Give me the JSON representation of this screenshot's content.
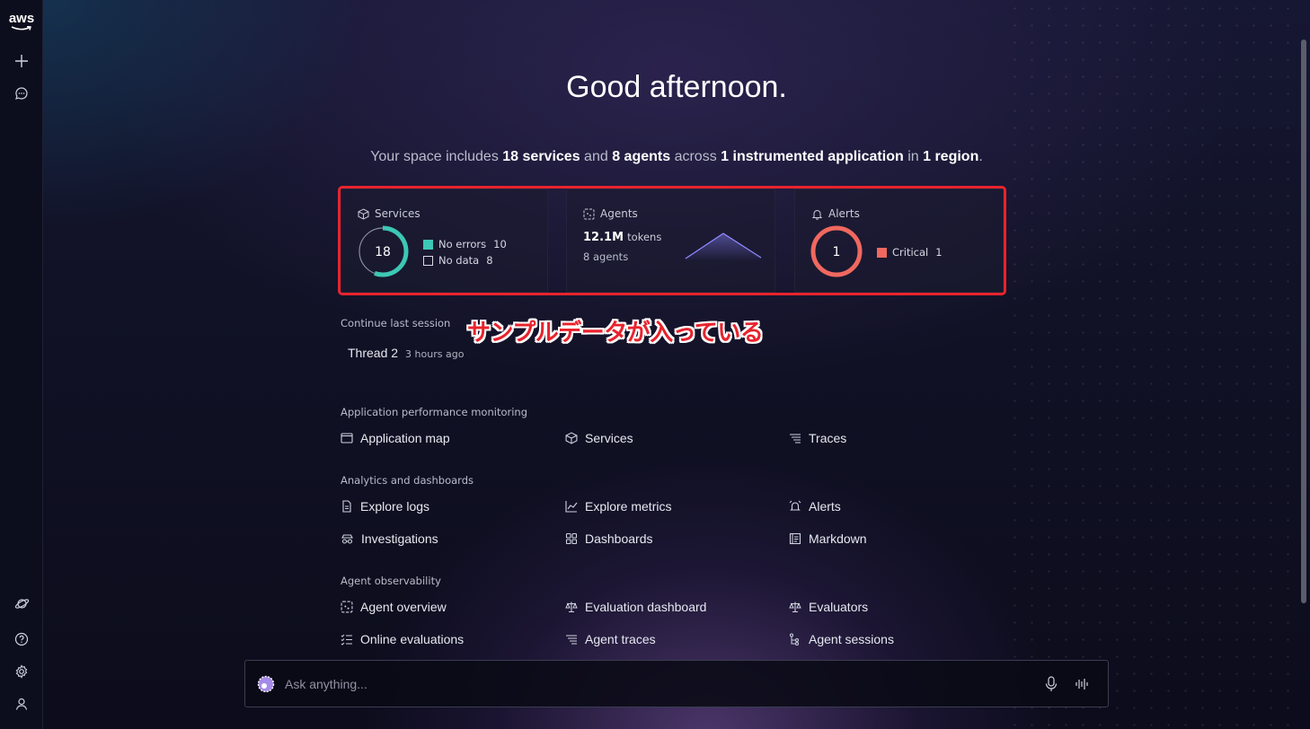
{
  "sidebar": {
    "logo": "aws"
  },
  "greeting": "Good afternoon.",
  "summary": {
    "prefix": "Your space includes",
    "services": "18 services",
    "and": "and",
    "agents": "8 agents",
    "across": "across",
    "apps": "1 instrumented application",
    "in": "in",
    "regions": "1 region",
    "end": "."
  },
  "cards": {
    "services": {
      "title": "Services",
      "total": "18",
      "legend": [
        {
          "label": "No errors",
          "value": "10",
          "color": "#3dc7b4"
        },
        {
          "label": "No data",
          "value": "8",
          "color": "transparent"
        }
      ]
    },
    "agents": {
      "title": "Agents",
      "tokens_value": "12.1M",
      "tokens_label": "tokens",
      "count_text": "8 agents"
    },
    "alerts": {
      "title": "Alerts",
      "total": "1",
      "legend": [
        {
          "label": "Critical",
          "value": "1",
          "color": "#f0685f"
        }
      ]
    }
  },
  "annotation": "サンプルデータが入っている",
  "session": {
    "label": "Continue last session",
    "thread": "Thread 2",
    "time": "3 hours ago"
  },
  "sections": [
    {
      "label": "Application performance monitoring",
      "links": [
        "Application map",
        "Services",
        "Traces"
      ]
    },
    {
      "label": "Analytics and dashboards",
      "links": [
        "Explore logs",
        "Explore metrics",
        "Alerts",
        "Investigations",
        "Dashboards",
        "Markdown"
      ]
    },
    {
      "label": "Agent observability",
      "links": [
        "Agent overview",
        "Evaluation dashboard",
        "Evaluators",
        "Online evaluations",
        "Agent traces",
        "Agent sessions"
      ]
    }
  ],
  "ask": {
    "placeholder": "Ask anything..."
  },
  "colors": {
    "teal": "#3dc7b4",
    "alert": "#f0685f",
    "annotation": "#e8232d"
  }
}
